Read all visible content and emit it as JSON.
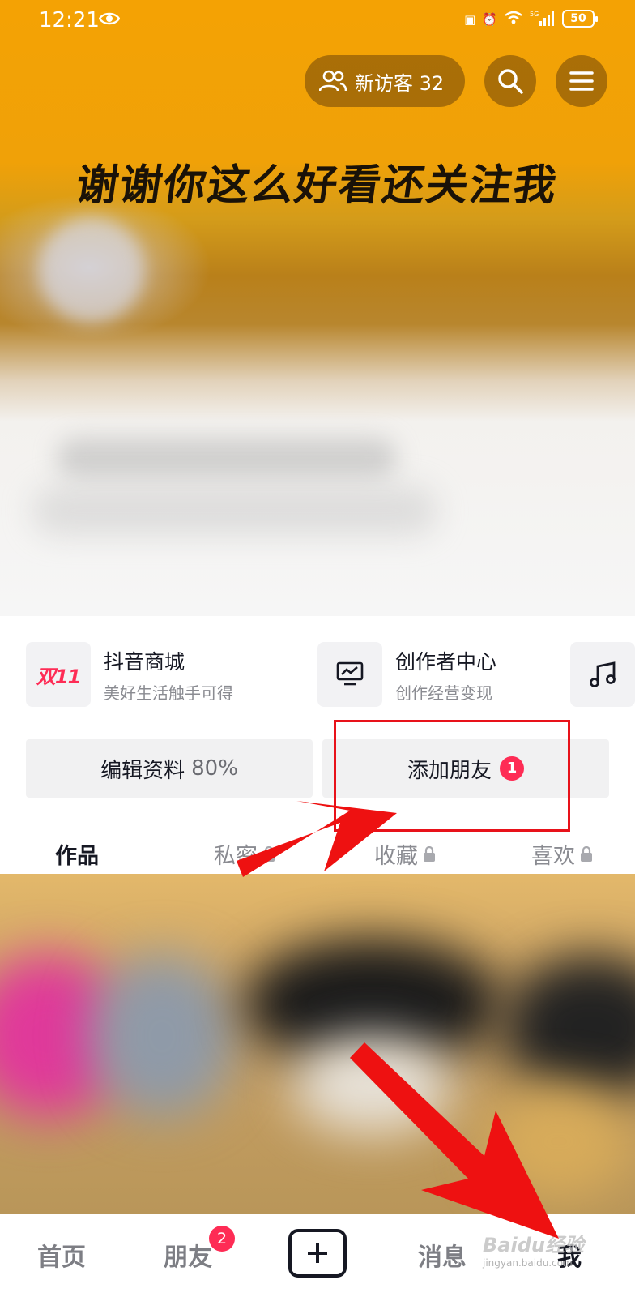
{
  "status_bar": {
    "time": "12:21",
    "battery": "50",
    "network": "5G"
  },
  "header": {
    "visitor_label": "新访客 32",
    "banner_text": "谢谢你这么好看还关注我"
  },
  "shortcuts": [
    {
      "icon_text": "双11",
      "title": "抖音商城",
      "subtitle": "美好生活触手可得"
    },
    {
      "title": "创作者中心",
      "subtitle": "创作经营变现"
    }
  ],
  "actions": {
    "edit_label": "编辑资料",
    "edit_percent": "80%",
    "add_friend_label": "添加朋友",
    "add_friend_badge": "1"
  },
  "tabs": [
    {
      "label": "作品",
      "active": true
    },
    {
      "label": "私密",
      "locked": true
    },
    {
      "label": "收藏",
      "locked": true
    },
    {
      "label": "喜欢",
      "locked": true
    }
  ],
  "bottom_nav": {
    "home": "首页",
    "friends": "朋友",
    "friends_badge": "2",
    "messages": "消息",
    "me": "我"
  },
  "watermark": {
    "brand": "Baidu经验",
    "url": "jingyan.baidu.com"
  },
  "colors": {
    "accent": "#fe2c55",
    "header": "#f4a204",
    "annotation": "#e8121a"
  }
}
